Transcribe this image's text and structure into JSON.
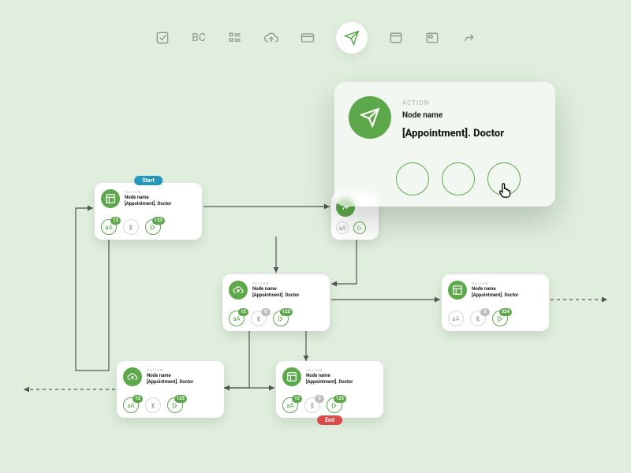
{
  "toolbar": {
    "items": [
      {
        "name": "checkbox-icon"
      },
      {
        "name": "text-icon",
        "label": "BC"
      },
      {
        "name": "list-icon"
      },
      {
        "name": "cloud-up-icon"
      },
      {
        "name": "card-icon"
      },
      {
        "name": "send-icon",
        "active": true
      },
      {
        "name": "window-icon"
      },
      {
        "name": "panel-icon"
      },
      {
        "name": "redo-icon"
      }
    ]
  },
  "popup": {
    "category": "ACTION",
    "name": "Node name",
    "subtitle": "[Appointment]. Doctor"
  },
  "nodes": {
    "n1": {
      "tag": "Start",
      "category": "ACTION",
      "name": "Node name",
      "subtitle": "[Appointment]. Doctor",
      "ports": {
        "p1_badge": "12",
        "p3_badge": "123"
      }
    },
    "n2": {
      "ports": {
        "p1_badge": "",
        "p2_badge": ""
      }
    },
    "n3": {
      "category": "ACTION",
      "name": "Node name",
      "subtitle": "[Appointment]. Doctor",
      "ports": {
        "p1_badge": "12",
        "p2_badge": "0",
        "p3_badge": "123"
      }
    },
    "n4": {
      "category": "ACTION",
      "name": "Node name",
      "subtitle": "[Appointment]. Doctor",
      "ports": {
        "p1_badge": "",
        "p2_badge": "0",
        "p3_badge": "324"
      }
    },
    "n5": {
      "category": "ACTION",
      "name": "Node name",
      "subtitle": "[Appointment]. Doctor",
      "ports": {
        "p1_badge": "12",
        "p2_badge": "",
        "p3_badge": "123"
      }
    },
    "n6": {
      "tag": "End",
      "category": "ACTION",
      "name": "Node name",
      "subtitle": "[Appointment]. Doctor",
      "ports": {
        "p1_badge": "12",
        "p2_badge": "0",
        "p3_badge": "123"
      }
    }
  }
}
